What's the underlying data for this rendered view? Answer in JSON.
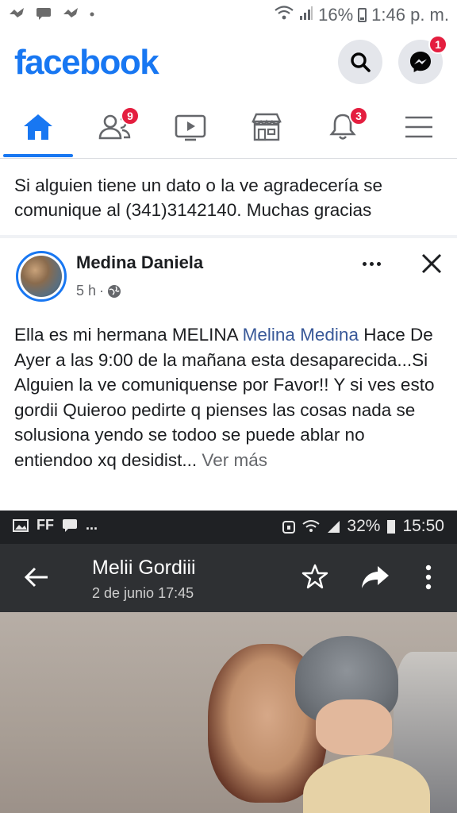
{
  "status_bar": {
    "battery": "16%",
    "time": "1:46 p. m.",
    "left_icons": [
      "notification-icon",
      "chat-icon",
      "notification-icon",
      "dot-icon"
    ]
  },
  "header": {
    "logo": "facebook",
    "search_icon": "search-icon",
    "messenger_icon": "messenger-icon",
    "messenger_badge": "1"
  },
  "tabs": [
    {
      "name": "home",
      "icon": "home-icon",
      "active": true,
      "badge": ""
    },
    {
      "name": "friends",
      "icon": "friends-icon",
      "active": false,
      "badge": "9"
    },
    {
      "name": "watch",
      "icon": "video-icon",
      "active": false,
      "badge": ""
    },
    {
      "name": "marketplace",
      "icon": "store-icon",
      "active": false,
      "badge": ""
    },
    {
      "name": "notifications",
      "icon": "bell-icon",
      "active": false,
      "badge": "3"
    },
    {
      "name": "menu",
      "icon": "menu-icon",
      "active": false,
      "badge": ""
    }
  ],
  "previous_post": {
    "text": "Si alguien tiene un dato o la ve agradecería se comunique al (341)3142140. Muchas gracias"
  },
  "post": {
    "author": "Medina Daniela",
    "time": "5 h",
    "separator": "·",
    "privacy_icon": "globe-icon",
    "body_prefix": "Ella  es mi hermana MELINA ",
    "mention": "Melina Medina",
    "body_rest": " Hace De Ayer a las 9:00 de la mañana esta desaparecida...Si Alguien la ve comuniquense por Favor!! Y si ves esto gordii Quieroo pedirte q pienses las cosas nada se solusiona yendo se todoo se puede ablar no entiendoo xq desidist...",
    "see_more": "Ver más"
  },
  "embedded_screenshot": {
    "status": {
      "left": "FF",
      "left_more": "...",
      "battery": "32%",
      "time": "15:50"
    },
    "title": "Melii Gordiii",
    "subtitle": "2 de junio 17:45"
  }
}
